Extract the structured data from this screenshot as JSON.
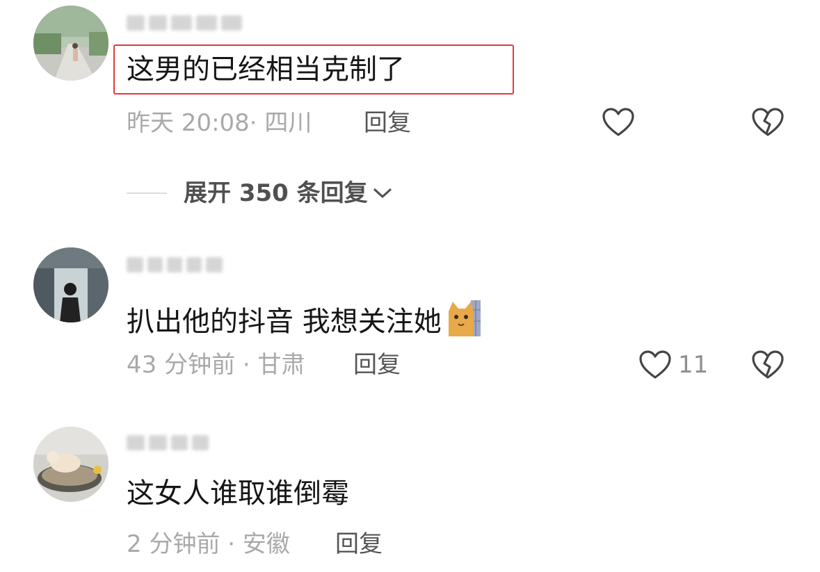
{
  "comments": [
    {
      "text": "这男的已经相当克制了",
      "time": "昨天 20:08",
      "location": "· 四川",
      "reply": "回复",
      "likes": ""
    },
    {
      "text": "扒出他的抖音 我想关注她",
      "time": "43 分钟前",
      "location": "· 甘肃",
      "reply": "回复",
      "likes": "11"
    },
    {
      "text": "这女人谁取谁倒霉",
      "time": "2 分钟前",
      "location": "· 安徽",
      "reply": "回复",
      "likes": ""
    }
  ],
  "expand_replies": {
    "label": "展开 350 条回复"
  },
  "colors": {
    "highlight": "#e5383b",
    "text": "#161616",
    "meta": "#a9a9a9"
  },
  "icons": [
    "heart-outline-icon",
    "broken-heart-icon",
    "chevron-down-icon",
    "cat-emoji"
  ]
}
